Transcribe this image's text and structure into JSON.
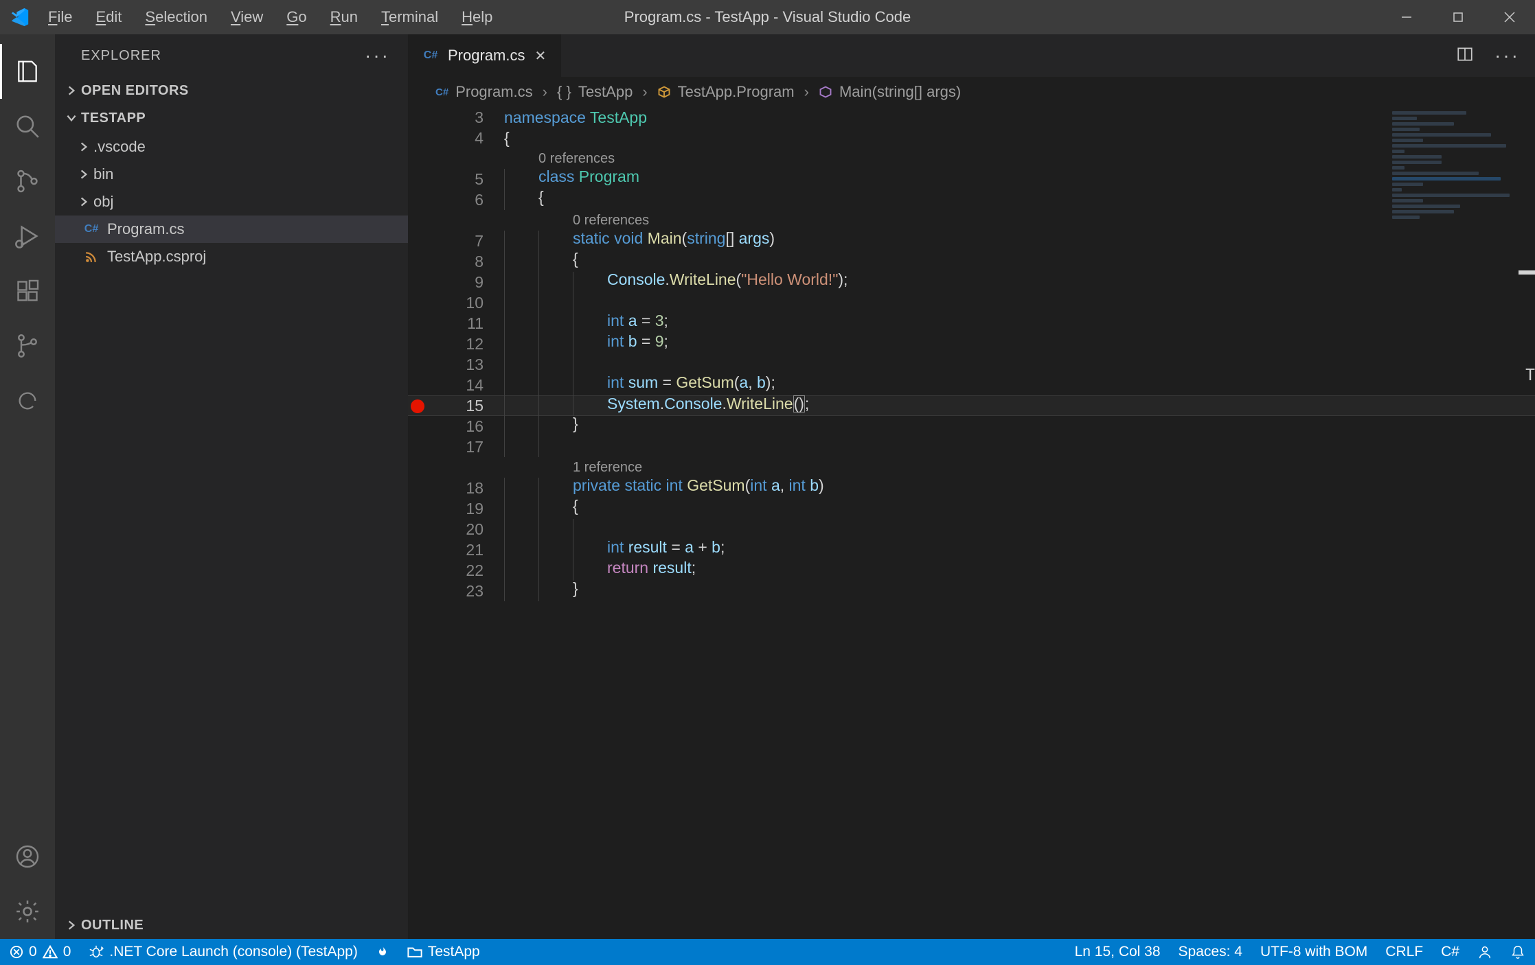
{
  "window": {
    "title": "Program.cs - TestApp - Visual Studio Code",
    "menu": [
      "File",
      "Edit",
      "Selection",
      "View",
      "Go",
      "Run",
      "Terminal",
      "Help"
    ]
  },
  "sidebar": {
    "title": "EXPLORER",
    "open_editors_label": "OPEN EDITORS",
    "workspace_label": "TESTAPP",
    "outline_label": "OUTLINE",
    "folders": [
      ".vscode",
      "bin",
      "obj"
    ],
    "files": [
      {
        "name": "Program.cs",
        "icon": "cs"
      },
      {
        "name": "TestApp.csproj",
        "icon": "rss"
      }
    ]
  },
  "tab": {
    "label": "Program.cs"
  },
  "breadcrumbs": {
    "items": [
      "Program.cs",
      "TestApp",
      "TestApp.Program",
      "Main(string[] args)"
    ]
  },
  "codelens": {
    "zero": "0 references",
    "one": "1 reference"
  },
  "code": {
    "l3_ns": "namespace",
    "l3_name": "TestApp",
    "l5_class": "class",
    "l5_name": "Program",
    "l7_static": "static",
    "l7_void": "void",
    "l7_main": "Main",
    "l7_string": "string",
    "l7_args": "args",
    "l9_console": "Console",
    "l9_wl": "WriteLine",
    "l9_str": "\"Hello World!\"",
    "l11_int": "int",
    "l11_a": "a",
    "l11_eq": "=",
    "l11_val": "3",
    "l12_int": "int",
    "l12_b": "b",
    "l12_eq": "=",
    "l12_val": "9",
    "l14_int": "int",
    "l14_sum": "sum",
    "l14_eq": "=",
    "l14_fn": "GetSum",
    "l14_a": "a",
    "l14_b": "b",
    "l15_sys": "System",
    "l15_console": "Console",
    "l15_wl": "WriteLine",
    "l18_priv": "private",
    "l18_static": "static",
    "l18_int": "int",
    "l18_fn": "GetSum",
    "l18_int2": "int",
    "l18_a": "a",
    "l18_int3": "int",
    "l18_b": "b",
    "l21_int": "int",
    "l21_res": "result",
    "l21_eq": "=",
    "l21_a": "a",
    "l21_plus": "+",
    "l21_b": "b",
    "l22_ret": "return",
    "l22_res": "result"
  },
  "line_numbers": [
    "3",
    "4",
    "5",
    "6",
    "7",
    "8",
    "9",
    "10",
    "11",
    "12",
    "13",
    "14",
    "15",
    "16",
    "17",
    "18",
    "19",
    "20",
    "21",
    "22",
    "23"
  ],
  "current_line": "15",
  "breakpoint_line": "15",
  "status": {
    "errors": "0",
    "warnings": "0",
    "launch": ".NET Core Launch (console) (TestApp)",
    "folder": "TestApp",
    "cursor": "Ln 15, Col 38",
    "spaces": "Spaces: 4",
    "encoding": "UTF-8 with BOM",
    "eol": "CRLF",
    "lang": "C#"
  }
}
